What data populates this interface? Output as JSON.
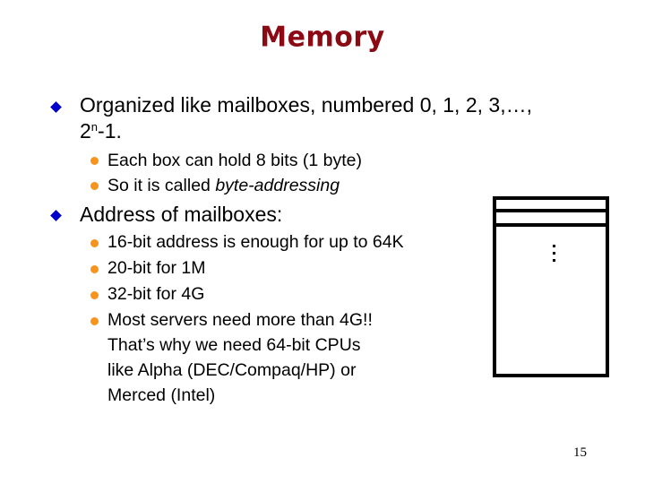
{
  "slide": {
    "title": "Memory",
    "page_number": "15",
    "colors": {
      "title": "#8b0a14",
      "level1_bullet": "#0000cc",
      "level2_bullet": "#f7941d"
    },
    "bullets": [
      {
        "icon": "diamond-bullet-icon",
        "line1": "Organized like mailboxes, numbered 0, 1, 2, 3,…,",
        "line2_base": "2",
        "line2_sup": "n",
        "line2_rest": "-1.",
        "sub": [
          {
            "icon": "dot-bullet-icon",
            "text": "Each box can hold 8 bits (1 byte)"
          },
          {
            "icon": "dot-bullet-icon",
            "text_prefix": "So it is called ",
            "text_italic": "byte-addressing"
          }
        ]
      },
      {
        "icon": "diamond-bullet-icon",
        "text": "Address of mailboxes:",
        "sub": [
          {
            "icon": "dot-bullet-icon",
            "text": "16-bit address is enough for up to 64K"
          },
          {
            "icon": "dot-bullet-icon",
            "text": "20-bit for 1M"
          },
          {
            "icon": "dot-bullet-icon",
            "text": "32-bit for 4G"
          },
          {
            "icon": "dot-bullet-icon",
            "lines": [
              "Most servers need more than 4G!!",
              "That’s why we need 64-bit CPUs",
              "like Alpha (DEC/Compaq/HP) or",
              "Merced (Intel)"
            ]
          }
        ]
      }
    ],
    "diagram": {
      "label": "memory-mailboxes-diagram",
      "ellipsis_icon": "vertical-ellipsis-icon"
    }
  }
}
